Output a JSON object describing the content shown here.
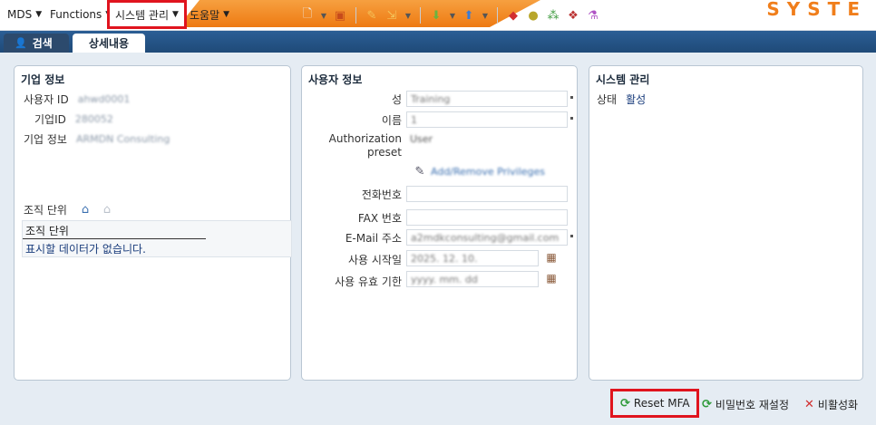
{
  "menubar": {
    "items": [
      {
        "label": "MDS"
      },
      {
        "label": "Functions"
      },
      {
        "label": "시스템 관리"
      },
      {
        "label": "도움말"
      }
    ],
    "brand": "SYSTE"
  },
  "tabs": [
    {
      "label": "검색",
      "active": false
    },
    {
      "label": "상세내용",
      "active": true
    }
  ],
  "company_panel": {
    "title": "기업 정보",
    "user_id_label": "사용자 ID",
    "user_id_value": "ahwd0001",
    "company_id_label": "기업ID",
    "company_id_value": "280052",
    "company_info_label": "기업 정보",
    "company_info_value": "ARMDN Consulting",
    "org_unit_label": "조직 단위",
    "org_table_header": "조직 단위",
    "org_table_empty": "표시할 데이터가 없습니다."
  },
  "user_panel": {
    "title": "사용자 정보",
    "last_name_label": "성",
    "last_name_value": "Training",
    "first_name_label": "이름",
    "first_name_value": "1",
    "auth_preset_label_1": "Authorization",
    "auth_preset_label_2": "preset",
    "auth_preset_value": "User",
    "add_privileges_link": "Add/Remove Privileges",
    "phone_label": "전화번호",
    "phone_value": "",
    "fax_label": "FAX 번호",
    "fax_value": "",
    "email_label": "E-Mail 주소",
    "email_value": "a2mdkconsulting@gmail.com",
    "start_date_label": "사용 시작일",
    "start_date_value": "2025. 12. 10.",
    "expiry_label": "사용 유효 기한",
    "expiry_value": "yyyy. mm. dd"
  },
  "system_panel": {
    "title": "시스템 관리",
    "status_label": "상태",
    "status_value": "활성"
  },
  "actions": {
    "reset_mfa": "Reset MFA",
    "reset_password": "비밀번호 재설정",
    "deactivate": "비활성화"
  },
  "colors": {
    "accent_orange": "#ee7a12",
    "tab_blue": "#1f4a78",
    "highlight_red": "#e0141e"
  }
}
